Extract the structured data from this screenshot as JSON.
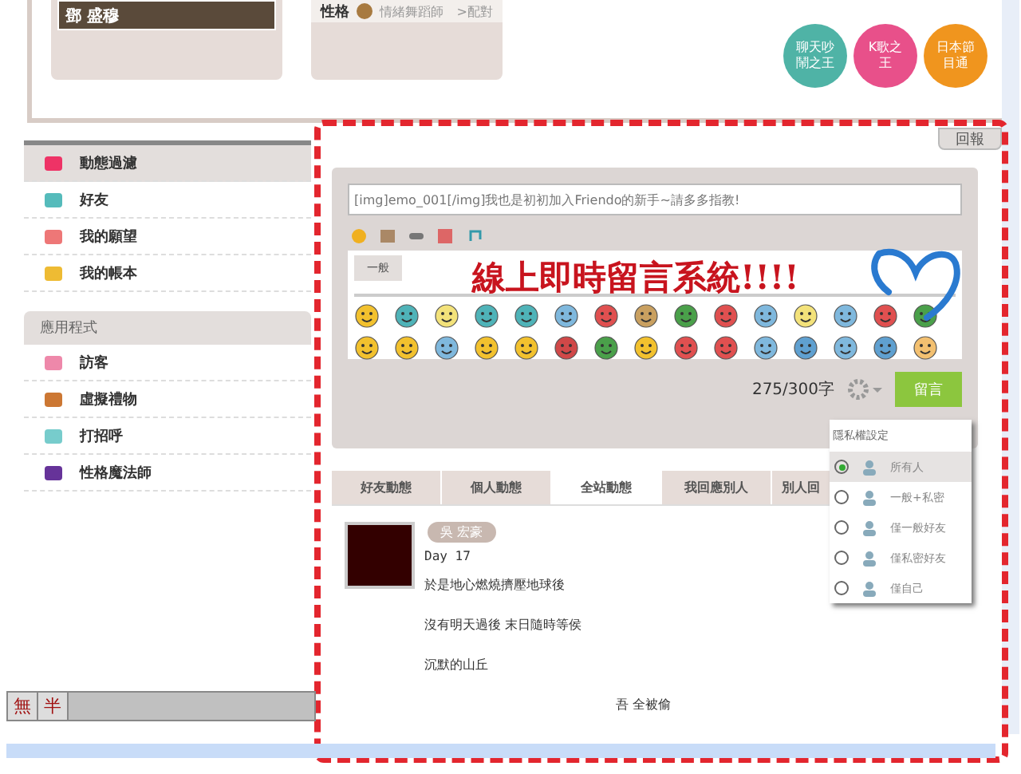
{
  "profile": {
    "photo_name": "鄧 盛穆",
    "trait_label": "性格",
    "trait_value": "情緒舞蹈師",
    "match_link": ">配對"
  },
  "badges": [
    {
      "label": "聊天吵鬧之王",
      "color": "#4fb3a6"
    },
    {
      "label": "K歌之王",
      "color": "#e8508a"
    },
    {
      "label": "日本節目通",
      "color": "#f0951e"
    }
  ],
  "report_button": "回報",
  "sidebar": {
    "items": [
      {
        "label": "動態過濾",
        "selected": true
      },
      {
        "label": "好友",
        "selected": false
      },
      {
        "label": "我的願望",
        "selected": false
      },
      {
        "label": "我的帳本",
        "selected": false
      }
    ],
    "section_title": "應用程式",
    "apps": [
      {
        "label": "訪客",
        "selected": false
      },
      {
        "label": "虛擬禮物",
        "selected": false
      },
      {
        "label": "打招呼",
        "selected": false
      },
      {
        "label": "性格魔法師",
        "selected": false
      }
    ]
  },
  "composer": {
    "value": "[img]emo_001[/img]我也是初初加入Friendo的新手~請多多指教!",
    "banner": "線上即時留言系統!!!!",
    "emoji_tabs": [
      {
        "label": "一般",
        "selected": true
      }
    ],
    "counter": "275/300字",
    "submit": "留言"
  },
  "privacy_menu": {
    "title": "隱私權設定",
    "options": [
      {
        "label": "所有人",
        "selected": true
      },
      {
        "label": "一般+私密",
        "selected": false
      },
      {
        "label": "僅一般好友",
        "selected": false
      },
      {
        "label": "僅私密好友",
        "selected": false
      },
      {
        "label": "僅自己",
        "selected": false
      }
    ]
  },
  "feed_tabs": [
    {
      "label": "好友動態",
      "selected": false
    },
    {
      "label": "個人動態",
      "selected": false
    },
    {
      "label": "全站動態",
      "selected": true
    },
    {
      "label": "我回應別人",
      "selected": false
    },
    {
      "label": "別人回",
      "selected": false
    }
  ],
  "post": {
    "author": "吳 宏豪",
    "title": "Day 17",
    "lines": [
      "於是地心燃燒擠壓地球後",
      "沒有明天過後 末日隨時等侯",
      "沉默的山丘",
      "吾 全被偷"
    ]
  },
  "ime_bar": {
    "keys": [
      "無",
      "半"
    ]
  }
}
